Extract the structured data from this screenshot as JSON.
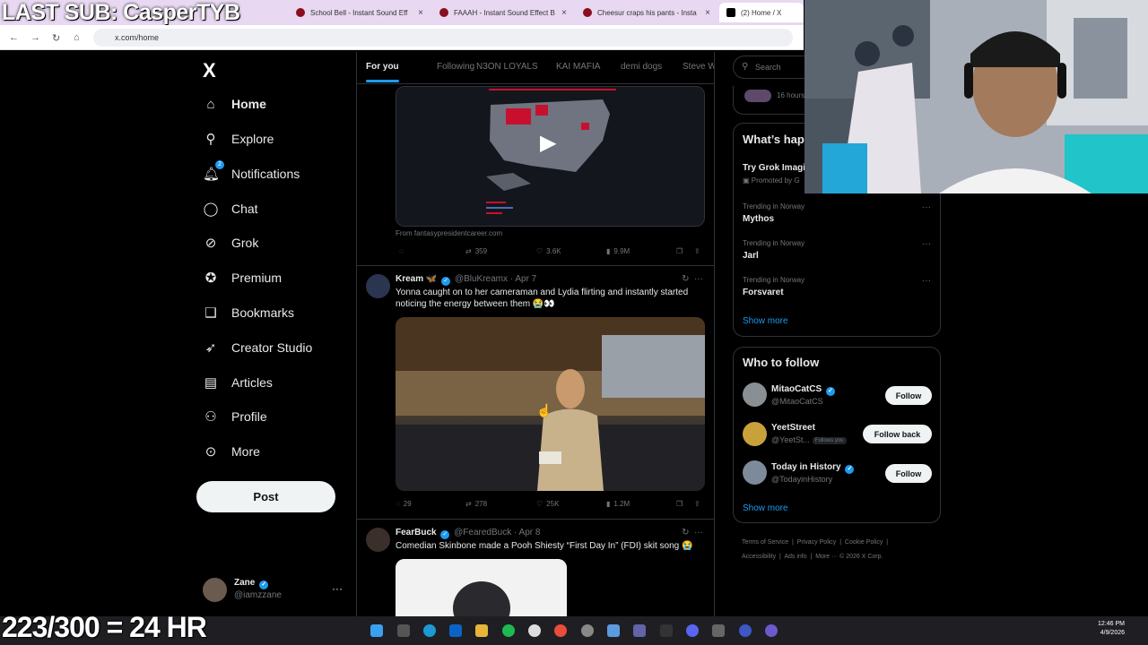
{
  "overlay": {
    "sub_text": "LAST SUB: CasperTYB",
    "progress_text": "223/300 = 24 HR"
  },
  "browser": {
    "tabs": [
      {
        "title": "School Bell - Instant Sound Eff"
      },
      {
        "title": "FAAAH - Instant Sound Effect B"
      },
      {
        "title": "Cheesur craps his pants - Insta"
      },
      {
        "title": "(2) Home / X"
      }
    ],
    "url": "x.com/home"
  },
  "sidebar": {
    "logo": "X",
    "items": [
      {
        "label": "Home",
        "icon": "home-icon"
      },
      {
        "label": "Explore",
        "icon": "search-icon"
      },
      {
        "label": "Notifications",
        "icon": "bell-icon",
        "badge": "2"
      },
      {
        "label": "Chat",
        "icon": "chat-icon"
      },
      {
        "label": "Grok",
        "icon": "grok-icon"
      },
      {
        "label": "Premium",
        "icon": "verified-icon"
      },
      {
        "label": "Bookmarks",
        "icon": "bookmark-icon"
      },
      {
        "label": "Creator Studio",
        "icon": "rocket-icon"
      },
      {
        "label": "Articles",
        "icon": "article-icon"
      },
      {
        "label": "Profile",
        "icon": "person-icon"
      },
      {
        "label": "More",
        "icon": "more-circle-icon"
      }
    ],
    "post_label": "Post",
    "account": {
      "name": "Zane",
      "handle": "@iamzzane"
    }
  },
  "feed": {
    "tabs": [
      "For you",
      "Following",
      "N3ON LOYALS",
      "KAI MAFIA",
      "demi dogs",
      "Steve W"
    ],
    "tweet0": {
      "source": "From fantasypresidentcareer.com",
      "retweets": "359",
      "likes": "3.6K",
      "views": "9.9M"
    },
    "tweet1": {
      "name": "Kream",
      "emoji": "🦋",
      "handle": "@BluKreamx",
      "date": "· Apr 7",
      "text": "Yonna caught on to her cameraman and Lydia flirting and instantly started noticing the energy between them 😭👀",
      "replies": "29",
      "retweets": "278",
      "likes": "25K",
      "views": "1.2M"
    },
    "tweet2": {
      "name": "FearBuck",
      "handle": "@FearedBuck",
      "date": "· Apr 8",
      "text": "Comedian Skinbone made a Pooh Shiesty “First Day In” (FDI) skit song 😭"
    }
  },
  "right": {
    "search_placeholder": "Search",
    "live_time": "16 hours",
    "happening": {
      "title": "What’s hap",
      "promo_title": "Try Grok Imagi",
      "promo_sub": "Promoted by G",
      "trends": [
        {
          "context": "Trending in Norway",
          "topic": "Mythos"
        },
        {
          "context": "Trending in Norway",
          "topic": "Jarl"
        },
        {
          "context": "Trending in Norway",
          "topic": "Forsvaret"
        }
      ],
      "show_more": "Show more"
    },
    "who_to_follow": {
      "title": "Who to follow",
      "accounts": [
        {
          "name": "MitaoCatCS",
          "handle": "@MitaoCatCS",
          "button": "Follow"
        },
        {
          "name": "YeetStreet",
          "handle": "@YeetSt...",
          "follows_you": "Follows you",
          "button": "Follow back"
        },
        {
          "name": "Today in History",
          "handle": "@TodayinHistory",
          "button": "Follow"
        }
      ],
      "show_more": "Show more"
    },
    "footer": {
      "links": [
        "Terms of Service",
        "Privacy Policy",
        "Cookie Policy",
        "Accessibility",
        "Ads info",
        "More ···"
      ],
      "copyright": "© 2026 X Corp."
    }
  },
  "taskbar": {
    "time": "12:46 PM",
    "date": "4/9/2026"
  },
  "colors": {
    "accent": "#1d9bf0",
    "background": "#000000",
    "border": "#2f3336",
    "muted": "#71767b"
  }
}
